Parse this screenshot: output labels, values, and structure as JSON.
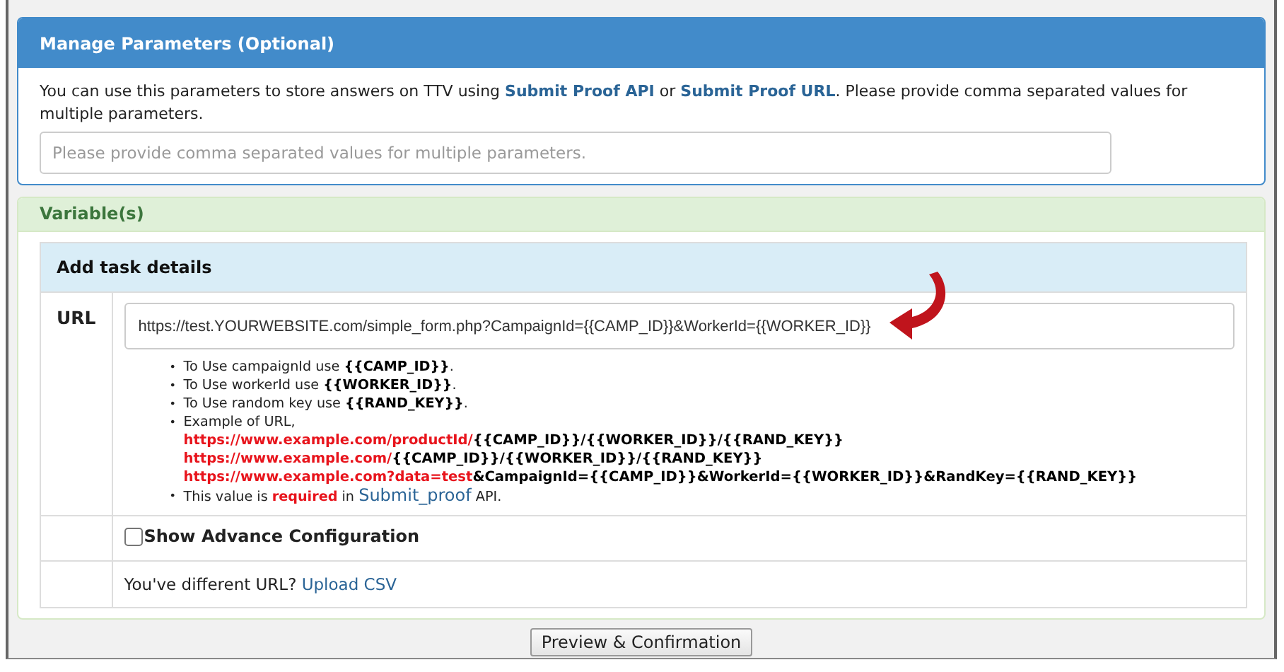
{
  "parameters_panel": {
    "title": "Manage Parameters (Optional)",
    "description": [
      {
        "kind": "plain",
        "text": "You can use this parameters to store answers on TTV using "
      },
      {
        "kind": "link",
        "text": "Submit Proof API"
      },
      {
        "kind": "plain",
        "text": " or "
      },
      {
        "kind": "link",
        "text": "Submit Proof URL"
      },
      {
        "kind": "plain",
        "text": ". Please provide comma separated values for multiple parameters."
      }
    ],
    "field": {
      "placeholder": "Please provide comma separated values for multiple parameters."
    }
  },
  "variables_panel": {
    "title": "Variable(s)",
    "table": {
      "heading": "Add task details",
      "url_row": {
        "label": "URL",
        "value": "https://test.YOURWEBSITE.com/simple_form.php?CampaignId={{CAMP_ID}}&WorkerId={{WORKER_ID}}",
        "hints": [
          {
            "bullet": "•",
            "segments": [
              {
                "kind": "plain",
                "text": "To Use campaignId use "
              },
              {
                "kind": "code",
                "text": "{{CAMP_ID}}"
              },
              {
                "kind": "plain",
                "text": "."
              }
            ]
          },
          {
            "bullet": "•",
            "segments": [
              {
                "kind": "plain",
                "text": "To Use workerId use "
              },
              {
                "kind": "code",
                "text": "{{WORKER_ID}}"
              },
              {
                "kind": "plain",
                "text": "."
              }
            ]
          },
          {
            "bullet": "•",
            "segments": [
              {
                "kind": "plain",
                "text": "To Use random key use "
              },
              {
                "kind": "code",
                "text": "{{RAND_KEY}}"
              },
              {
                "kind": "plain",
                "text": "."
              }
            ]
          },
          {
            "bullet": "•",
            "segments": [
              {
                "kind": "plain",
                "text": "Example of URL,"
              }
            ],
            "examples": [
              [
                {
                  "kind": "red",
                  "text": "https://www.example.com/productId/"
                },
                {
                  "kind": "code",
                  "text": "{{CAMP_ID}}/{{WORKER_ID}}/{{RAND_KEY}}"
                }
              ],
              [
                {
                  "kind": "red",
                  "text": "https://www.example.com/"
                },
                {
                  "kind": "code",
                  "text": "{{CAMP_ID}}/{{WORKER_ID}}/{{RAND_KEY}}"
                }
              ],
              [
                {
                  "kind": "red",
                  "text": "https://www.example.com?data=test"
                },
                {
                  "kind": "code",
                  "text": "&CampaignId={{CAMP_ID}}&WorkerId={{WORKER_ID}}&RandKey={{RAND_KEY}}"
                }
              ]
            ]
          },
          {
            "bullet": "•",
            "segments": [
              {
                "kind": "plain",
                "text": "This value is "
              },
              {
                "kind": "red",
                "text": "required"
              },
              {
                "kind": "plain",
                "text": " in "
              },
              {
                "kind": "link",
                "text": "Submit_proof"
              },
              {
                "kind": "plain",
                "text": " API."
              }
            ]
          }
        ]
      },
      "advanced": {
        "label": "Show Advance Configuration",
        "checked": false
      },
      "upload_row": {
        "text": "You've different URL?",
        "link": "Upload CSV"
      }
    }
  },
  "confirm_button": "Preview & Confirmation"
}
